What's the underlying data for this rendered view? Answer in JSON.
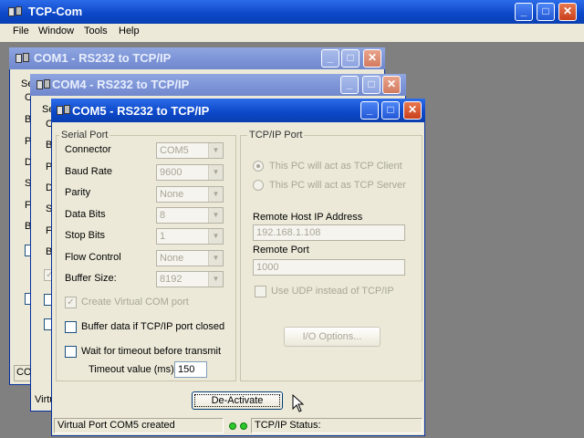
{
  "app": {
    "title": "TCP-Com",
    "menu": [
      "File",
      "Window",
      "Tools",
      "Help"
    ]
  },
  "windows": {
    "com1": {
      "title": "COM1 - RS232 to TCP/IP"
    },
    "com4": {
      "title": "COM4 - RS232 to TCP/IP"
    },
    "com5": {
      "title": "COM5 - RS232 to TCP/IP"
    }
  },
  "bg_fragments": {
    "com1_left_letters": [
      "Se",
      "C",
      "B",
      "P",
      "D",
      "S",
      "F",
      "B"
    ],
    "com4_left_letters": [
      "Se",
      "C",
      "B",
      "P",
      "D",
      "S",
      "F",
      "B"
    ],
    "com1_bottom": "COM",
    "com4_bottom": "Virtu"
  },
  "serial": {
    "group_label": "Serial Port",
    "connector": {
      "label": "Connector",
      "value": "COM5"
    },
    "baud": {
      "label": "Baud Rate",
      "value": "9600"
    },
    "parity": {
      "label": "Parity",
      "value": "None"
    },
    "databits": {
      "label": "Data Bits",
      "value": "8"
    },
    "stopbits": {
      "label": "Stop Bits",
      "value": "1"
    },
    "flow": {
      "label": "Flow Control",
      "value": "None"
    },
    "buffer": {
      "label": "Buffer Size:",
      "value": "8192"
    },
    "create_virtual": "Create Virtual COM port",
    "buffer_closed": "Buffer data if TCP/IP port closed",
    "wait_timeout": "Wait for timeout before transmit",
    "timeout_label": "Timeout value (ms):",
    "timeout_value": "150"
  },
  "tcp": {
    "group_label": "TCP/IP Port",
    "client": "This PC will act as TCP Client",
    "server": "This PC will act as TCP Server",
    "host_label": "Remote Host IP Address",
    "host_value": "192.168.1.108",
    "port_label": "Remote Port",
    "port_value": "1000",
    "udp": "Use UDP instead of TCP/IP",
    "io_options": "I/O Options..."
  },
  "deactivate": "De-Activate",
  "status": {
    "left": "Virtual Port COM5 created",
    "right": "TCP/IP Status:"
  },
  "colors": {
    "titlebar_active": "#0b47c8",
    "window_bg": "#ece9d8",
    "led": "#2ec82e"
  }
}
